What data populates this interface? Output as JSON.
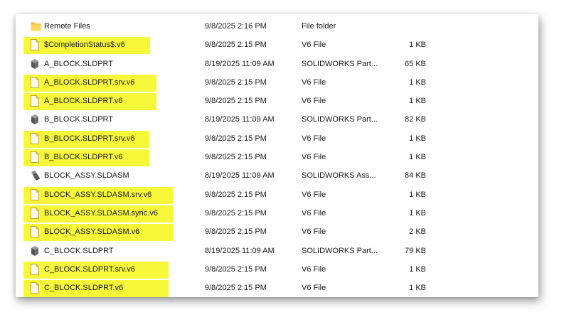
{
  "colors": {
    "highlight": "#f7f73a",
    "folder": "#f5c84c",
    "file_outline": "#c9a227"
  },
  "files": [
    {
      "name": "Remote Files",
      "date": "9/8/2025 2:16 PM",
      "type": "File folder",
      "size": "",
      "icon": "folder-icon",
      "highlighted": false
    },
    {
      "name": "$CompletionStatus$.v6",
      "date": "9/8/2025 2:15 PM",
      "type": "V6 File",
      "size": "1 KB",
      "icon": "file-icon",
      "highlighted": true
    },
    {
      "name": "A_BLOCK.SLDPRT",
      "date": "8/19/2025 11:09 AM",
      "type": "SOLIDWORKS Part...",
      "size": "65 KB",
      "icon": "solidworks-part-icon",
      "highlighted": false
    },
    {
      "name": "A_BLOCK.SLDPRT.srv.v6",
      "date": "9/8/2025 2:15 PM",
      "type": "V6 File",
      "size": "1 KB",
      "icon": "file-icon",
      "highlighted": true
    },
    {
      "name": "A_BLOCK.SLDPRT.v6",
      "date": "9/8/2025 2:15 PM",
      "type": "V6 File",
      "size": "1 KB",
      "icon": "file-icon",
      "highlighted": true
    },
    {
      "name": "B_BLOCK.SLDPRT",
      "date": "8/19/2025 11:09 AM",
      "type": "SOLIDWORKS Part...",
      "size": "82 KB",
      "icon": "solidworks-part-icon",
      "highlighted": false
    },
    {
      "name": "B_BLOCK.SLDPRT.srv.v6",
      "date": "9/8/2025 2:15 PM",
      "type": "V6 File",
      "size": "1 KB",
      "icon": "file-icon",
      "highlighted": true
    },
    {
      "name": "B_BLOCK.SLDPRT.v6",
      "date": "9/8/2025 2:15 PM",
      "type": "V6 File",
      "size": "1 KB",
      "icon": "file-icon",
      "highlighted": true
    },
    {
      "name": "BLOCK_ASSY.SLDASM",
      "date": "8/19/2025 11:09 AM",
      "type": "SOLIDWORKS Ass...",
      "size": "84 KB",
      "icon": "solidworks-assembly-icon",
      "highlighted": false
    },
    {
      "name": "BLOCK_ASSY.SLDASM.srv.v6",
      "date": "9/8/2025 2:15 PM",
      "type": "V6 File",
      "size": "1 KB",
      "icon": "file-icon",
      "highlighted": true
    },
    {
      "name": "BLOCK_ASSY.SLDASM.sync.v6",
      "date": "9/8/2025 2:15 PM",
      "type": "V6 File",
      "size": "1 KB",
      "icon": "file-icon",
      "highlighted": true
    },
    {
      "name": "BLOCK_ASSY.SLDASM.v6",
      "date": "9/8/2025 2:15 PM",
      "type": "V6 File",
      "size": "2 KB",
      "icon": "file-icon",
      "highlighted": true
    },
    {
      "name": "C_BLOCK.SLDPRT",
      "date": "8/19/2025 11:09 AM",
      "type": "SOLIDWORKS Part...",
      "size": "79 KB",
      "icon": "solidworks-part-icon",
      "highlighted": false
    },
    {
      "name": "C_BLOCK.SLDPRT.srv.v6",
      "date": "9/8/2025 2:15 PM",
      "type": "V6 File",
      "size": "1 KB",
      "icon": "file-icon",
      "highlighted": true
    },
    {
      "name": "C_BLOCK.SLDPRT.v6",
      "date": "9/8/2025 2:15 PM",
      "type": "V6 File",
      "size": "1 KB",
      "icon": "file-icon",
      "highlighted": true
    }
  ]
}
